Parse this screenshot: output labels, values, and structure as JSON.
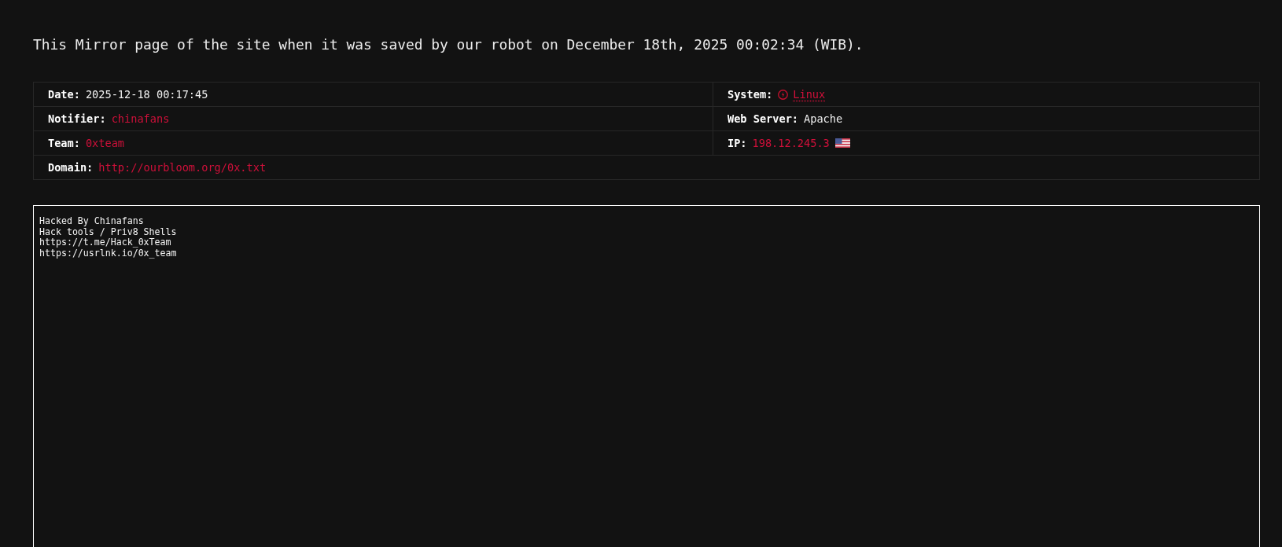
{
  "notice": "This Mirror page of the site when it was saved by our robot on December 18th, 2025 00:02:34 (WIB).",
  "info_table": {
    "rows": [
      {
        "cells": [
          {
            "label": "Date:",
            "value": "2025-12-18 00:17:45",
            "kind": "text"
          },
          {
            "label": "System:",
            "value": "Linux",
            "kind": "os_link"
          }
        ]
      },
      {
        "cells": [
          {
            "label": "Notifier:",
            "value": "chinafans",
            "kind": "link"
          },
          {
            "label": "Web Server:",
            "value": "Apache",
            "kind": "text"
          }
        ]
      },
      {
        "cells": [
          {
            "label": "Team:",
            "value": "0xteam",
            "kind": "link"
          },
          {
            "label": "IP:",
            "value": "198.12.245.3",
            "kind": "ip"
          }
        ]
      },
      {
        "cells": [
          {
            "label": "Domain:",
            "value": "http://ourbloom.org/0x.txt",
            "kind": "link"
          }
        ]
      }
    ]
  },
  "mirror_frame": {
    "lines": [
      "Hacked By Chinafans",
      "Hack tools / Priv8 Shells",
      "https://t.me/Hack_0xTeam",
      "https://usrlnk.io/0x_team"
    ]
  }
}
